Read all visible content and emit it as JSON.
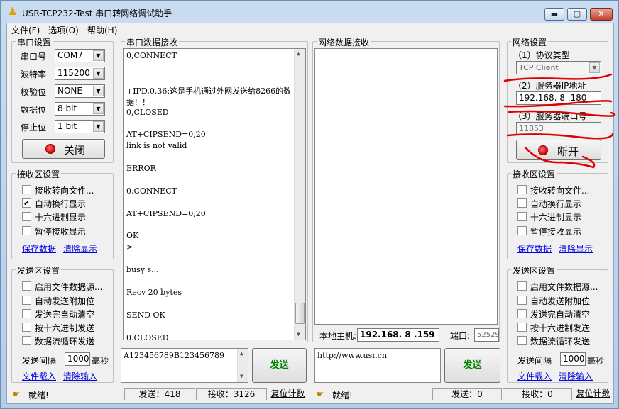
{
  "window": {
    "title": "USR-TCP232-Test 串口转网络调试助手",
    "minimize": "▬",
    "maximize": "▢",
    "close": "✕"
  },
  "menu": [
    "文件(F)",
    "选项(O)",
    "帮助(H)"
  ],
  "serial_settings": {
    "title": "串口设置",
    "fields": [
      {
        "label": "串口号",
        "value": "COM7"
      },
      {
        "label": "波特率",
        "value": "115200"
      },
      {
        "label": "校验位",
        "value": "NONE"
      },
      {
        "label": "数据位",
        "value": "8 bit"
      },
      {
        "label": "停止位",
        "value": "1 bit"
      }
    ],
    "toggle_label": "关闭"
  },
  "serial_receive_settings": {
    "title": "接收区设置",
    "options": [
      {
        "label": "接收转向文件...",
        "checked": false
      },
      {
        "label": "自动换行显示",
        "checked": true
      },
      {
        "label": "十六进制显示",
        "checked": false
      },
      {
        "label": "暂停接收显示",
        "checked": false
      }
    ],
    "save_link": "保存数据",
    "clear_link": "清除显示"
  },
  "serial_send_settings": {
    "title": "发送区设置",
    "options": [
      {
        "label": "启用文件数据源...",
        "checked": false
      },
      {
        "label": "自动发送附加位",
        "checked": false
      },
      {
        "label": "发送完自动清空",
        "checked": false
      },
      {
        "label": "按十六进制发送",
        "checked": false
      },
      {
        "label": "数据流循环发送",
        "checked": false
      }
    ],
    "interval_label": "发送间隔",
    "interval_value": "1000",
    "interval_unit": "毫秒",
    "load_link": "文件载入",
    "clear_link": "清除输入"
  },
  "serial_receive": {
    "title": "串口数据接收",
    "lines": [
      "0,CONNECT",
      "",
      "",
      "+IPD,0,36:这是手机通过外网发送给8266的数",
      "据！！",
      "0,CLOSED",
      "",
      "AT+CIPSEND=0,20",
      "link is not valid",
      "",
      "ERROR",
      "",
      "0,CONNECT",
      "",
      "AT+CIPSEND=0,20",
      "",
      "OK",
      ">",
      "",
      "busy s...",
      "",
      "Recv 20 bytes",
      "",
      "SEND OK",
      "",
      "0,CLOSED"
    ],
    "send_text": "A123456789B123456789",
    "send_button": "发送"
  },
  "network_receive": {
    "title": "网络数据接收",
    "local_host_label": "本地主机:",
    "local_host_value": "192.168. 8 .159",
    "port_label": "端口:",
    "port_value": "52529",
    "send_text": "http://www.usr.cn",
    "send_button": "发送"
  },
  "network_settings": {
    "title": "网络设置",
    "protocol_label": "（1）协议类型",
    "protocol_value": "TCP Client",
    "server_ip_label": "（2）服务器IP地址",
    "server_ip_value": "192.168. 8 .180",
    "server_port_label": "（3）服务器端口号",
    "server_port_value": "11853",
    "toggle_label": "断开"
  },
  "network_receive_settings": {
    "title": "接收区设置",
    "options": [
      {
        "label": "接收转向文件...",
        "checked": false
      },
      {
        "label": "自动换行显示",
        "checked": false
      },
      {
        "label": "十六进制显示",
        "checked": false
      },
      {
        "label": "暂停接收显示",
        "checked": false
      }
    ],
    "save_link": "保存数据",
    "clear_link": "清除显示"
  },
  "network_send_settings": {
    "title": "发送区设置",
    "options": [
      {
        "label": "启用文件数据源...",
        "checked": false
      },
      {
        "label": "自动发送附加位",
        "checked": false
      },
      {
        "label": "发送完自动清空",
        "checked": false
      },
      {
        "label": "按十六进制发送",
        "checked": false
      },
      {
        "label": "数据流循环发送",
        "checked": false
      }
    ],
    "interval_label": "发送间隔",
    "interval_value": "1000",
    "interval_unit": "毫秒",
    "load_link": "文件载入",
    "clear_link": "清除输入"
  },
  "status_left": {
    "ready": "就绪!",
    "send": "发送：418",
    "recv": "接收：3126",
    "reset": "复位计数"
  },
  "status_right": {
    "ready": "就绪!",
    "send": "发送：0",
    "recv": "接收：0",
    "reset": "复位计数"
  },
  "colors": {
    "annotation_red": "#e00000",
    "send_green": "#008000",
    "link_blue": "#0000e0"
  }
}
